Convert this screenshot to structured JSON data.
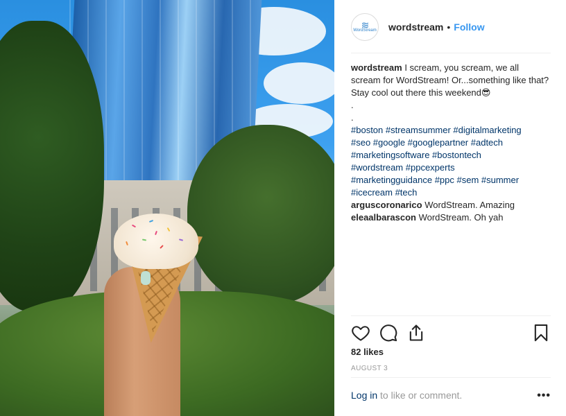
{
  "post": {
    "username": "wordstream",
    "separator": "•",
    "follow_label": "Follow",
    "avatar_wave": "≋",
    "avatar_brand": "WordStream",
    "caption": {
      "username": "wordstream",
      "text": "I scream, you scream, we all scream for WordStream! Or...something like that? Stay cool out there this weekend😎",
      "dot1": ".",
      "dot2": ".",
      "hashtags_line1": "#boston #streamsummer #digitalmarketing",
      "hashtags_line2": "#seo #google #googlepartner #adtech",
      "hashtags_line3": "#marketingsoftware #bostontech",
      "hashtags_line4": "#wordstream #ppcexperts",
      "hashtags_line5": "#marketingguidance #ppc #sem #summer",
      "hashtags_line6": "#icecream #tech"
    },
    "comments": [
      {
        "username": "arguscoronarico",
        "text": "WordStream. Amazing"
      },
      {
        "username": "eleaalbarascon",
        "text": "WordStream. Oh yah"
      }
    ],
    "likes": "82 likes",
    "date": "AUGUST 3",
    "footer": {
      "login_label": "Log in",
      "rest": " to like or comment.",
      "more": "•••"
    },
    "icons": {
      "like": "heart-icon",
      "comment": "comment-icon",
      "share": "share-icon",
      "save": "bookmark-icon"
    }
  }
}
